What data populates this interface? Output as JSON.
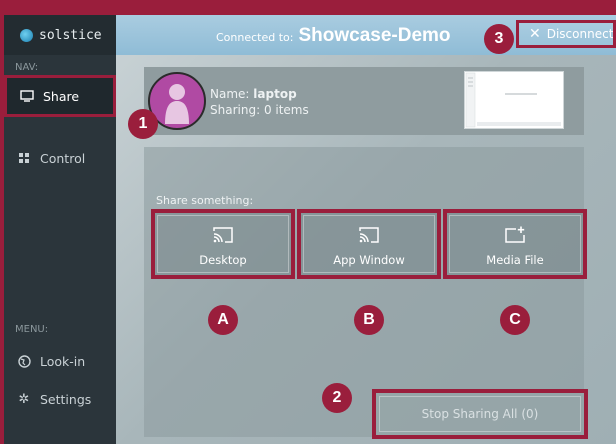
{
  "app": {
    "name": "solstice"
  },
  "header": {
    "connected_label": "Connected to:",
    "host": "Showcase-Demo",
    "disconnect_label": "Disconnect"
  },
  "sidebar": {
    "nav_label": "NAV:",
    "nav_items": [
      {
        "label": "Share",
        "icon": "monitor-icon",
        "active": true
      },
      {
        "label": "Control",
        "icon": "grid-icon",
        "active": false
      }
    ],
    "menu_label": "MENU:",
    "menu_items": [
      {
        "label": "Look-in",
        "icon": "globe-icon"
      },
      {
        "label": "Settings",
        "icon": "gear-icon"
      }
    ]
  },
  "user": {
    "name_prefix": "Name:",
    "name": "laptop",
    "sharing_prefix": "Sharing:",
    "sharing": "0 items"
  },
  "share": {
    "prompt": "Share something:",
    "buttons": [
      {
        "label": "Desktop",
        "icon": "cast-icon",
        "marker": "A"
      },
      {
        "label": "App Window",
        "icon": "cast-icon",
        "marker": "B"
      },
      {
        "label": "Media File",
        "icon": "add-file-icon",
        "marker": "C"
      }
    ],
    "stop_label": "Stop Sharing All (0)"
  },
  "markers": {
    "one": "1",
    "two": "2",
    "three": "3"
  },
  "colors": {
    "highlight": "#9a1e3c",
    "sidebar": "#2b353b",
    "header": "#a9cce0"
  }
}
